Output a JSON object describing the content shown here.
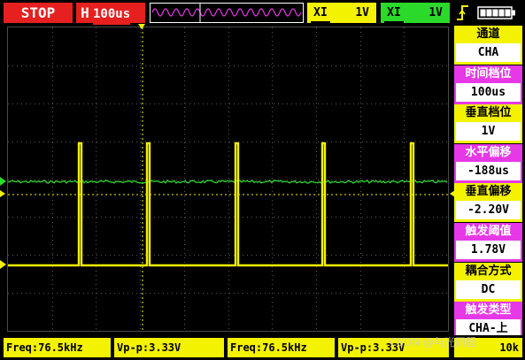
{
  "topbar": {
    "run_state": "STOP",
    "timebase_label": "H",
    "timebase_value": "100us",
    "ch1_tag": "XI",
    "ch1_scale": "1V",
    "ch2_tag": "XI",
    "ch2_scale": "1V",
    "trigger_icon": "trigger-rising-edge-icon",
    "battery_icon": "battery-full-icon"
  },
  "menu": {
    "items": [
      {
        "label": "通道",
        "value": "CHA",
        "color": "yellow"
      },
      {
        "label": "时间档位",
        "value": "100us",
        "color": "magenta"
      },
      {
        "label": "垂直档位",
        "value": "1V",
        "color": "yellow"
      },
      {
        "label": "水平偏移",
        "value": "-188us",
        "color": "magenta"
      },
      {
        "label": "垂直偏移",
        "value": "-2.20V",
        "color": "yellow"
      },
      {
        "label": "触发阈值",
        "value": "1.78V",
        "color": "magenta"
      },
      {
        "label": "耦合方式",
        "value": "DC",
        "color": "yellow"
      },
      {
        "label": "触发类型",
        "value": "CHA-上",
        "color": "magenta"
      }
    ]
  },
  "measurements": [
    "Freq:76.5kHz",
    "Vp-p:3.33V",
    "Freq:76.5kHz",
    "Vp-p:3.33V"
  ],
  "bottom_right": "10k",
  "watermark": "CSDN @与光同程",
  "colors": {
    "ch1": "#f3f200",
    "ch2": "#2bd92b",
    "red": "#e5201f",
    "magenta": "#e638e6",
    "grid": "#5a5a5a"
  }
}
